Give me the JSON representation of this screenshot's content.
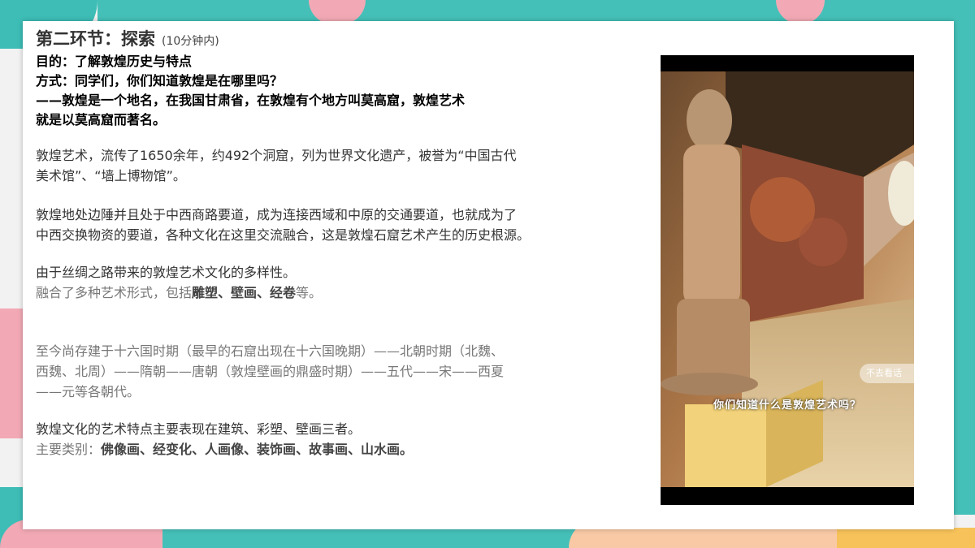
{
  "title": "第二环节：探索",
  "title_note": "(10分钟内)",
  "bold_lines": [
    "目的：了解敦煌历史与特点",
    "方式：同学们，你们知道敦煌是在哪里吗？",
    "——敦煌是一个地名，在我国甘肃省，在敦煌有个地方叫莫高窟，敦煌艺术",
    "就是以莫高窟而著名。"
  ],
  "para1": [
    "敦煌艺术，流传了1650余年，约492个洞窟，列为世界文化遗产，被誉为“中国古代",
    "美术馆”、“墙上博物馆”。"
  ],
  "para2": [
    "敦煌地处边陲并且处于中西商路要道，成为连接西域和中原的交通要道，也就成为了",
    "中西交换物资的要道，各种文化在这里交流融合，这是敦煌石窟艺术产生的历史根源。"
  ],
  "para3_line1": "由于丝绸之路带来的敦煌艺术文化的多样性。",
  "para3_line2_prefix": "融合了多种艺术形式，包括",
  "para3_line2_bold": "雕塑、壁画、经卷",
  "para3_line2_suffix": "等。",
  "para4": [
    "至今尚存建于十六国时期（最早的石窟出现在十六国晚期）——北朝时期（北魏、",
    "西魏、北周）——隋朝——唐朝（敦煌壁画的鼎盛时期）——五代——宋——西夏",
    "——元等各朝代。"
  ],
  "para5_line1": "敦煌文化的艺术特点主要表现在建筑、彩塑、壁画三者。",
  "para5_line2_prefix": "主要类别：",
  "para5_line2_bold": "佛像画、经变化、人画像、装饰画、故事画、山水画。",
  "video": {
    "caption": "你们知道什么是敦煌艺术吗？",
    "watermark": "不去看话"
  },
  "colors": {
    "teal": "#3dbdb6",
    "pink": "#f2a9b5",
    "yellow": "#f7c25a",
    "peach": "#f9c9a5"
  }
}
